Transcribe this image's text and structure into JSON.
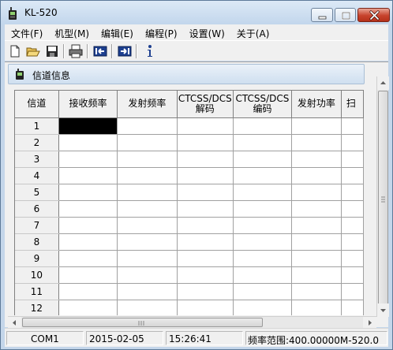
{
  "window": {
    "title": "KL-520",
    "minimize_label": "",
    "maximize_label": "",
    "close_label": ""
  },
  "menu": [
    {
      "label": "文件(F)"
    },
    {
      "label": "机型(M)"
    },
    {
      "label": "编辑(E)"
    },
    {
      "label": "编程(P)"
    },
    {
      "label": "设置(W)"
    },
    {
      "label": "关于(A)"
    }
  ],
  "toolbar": {
    "icons": [
      "new-file-icon",
      "open-folder-icon",
      "save-icon",
      "print-icon",
      "read-from-radio-icon",
      "write-to-radio-icon",
      "info-icon"
    ]
  },
  "panel": {
    "title": "信道信息"
  },
  "grid": {
    "headers": {
      "channel": "信道",
      "rx_freq": "接收频率",
      "tx_freq": "发射频率",
      "ctcss_decode_1": "CTCSS/DCS",
      "ctcss_decode_2": "解码",
      "ctcss_encode_1": "CTCSS/DCS",
      "ctcss_encode_2": "编码",
      "tx_power": "发射功率",
      "scan": "扫"
    },
    "rows": [
      "1",
      "2",
      "3",
      "4",
      "5",
      "6",
      "7",
      "8",
      "9",
      "10",
      "11",
      "12"
    ]
  },
  "status": {
    "port": "COM1",
    "date": "2015-02-05",
    "time": "15:26:41",
    "freq_range": "频率范围:400.00000M-520.0"
  },
  "colors": {
    "frame": "#c4d6ea",
    "close_button": "#c7432c",
    "selection": "#000000"
  }
}
